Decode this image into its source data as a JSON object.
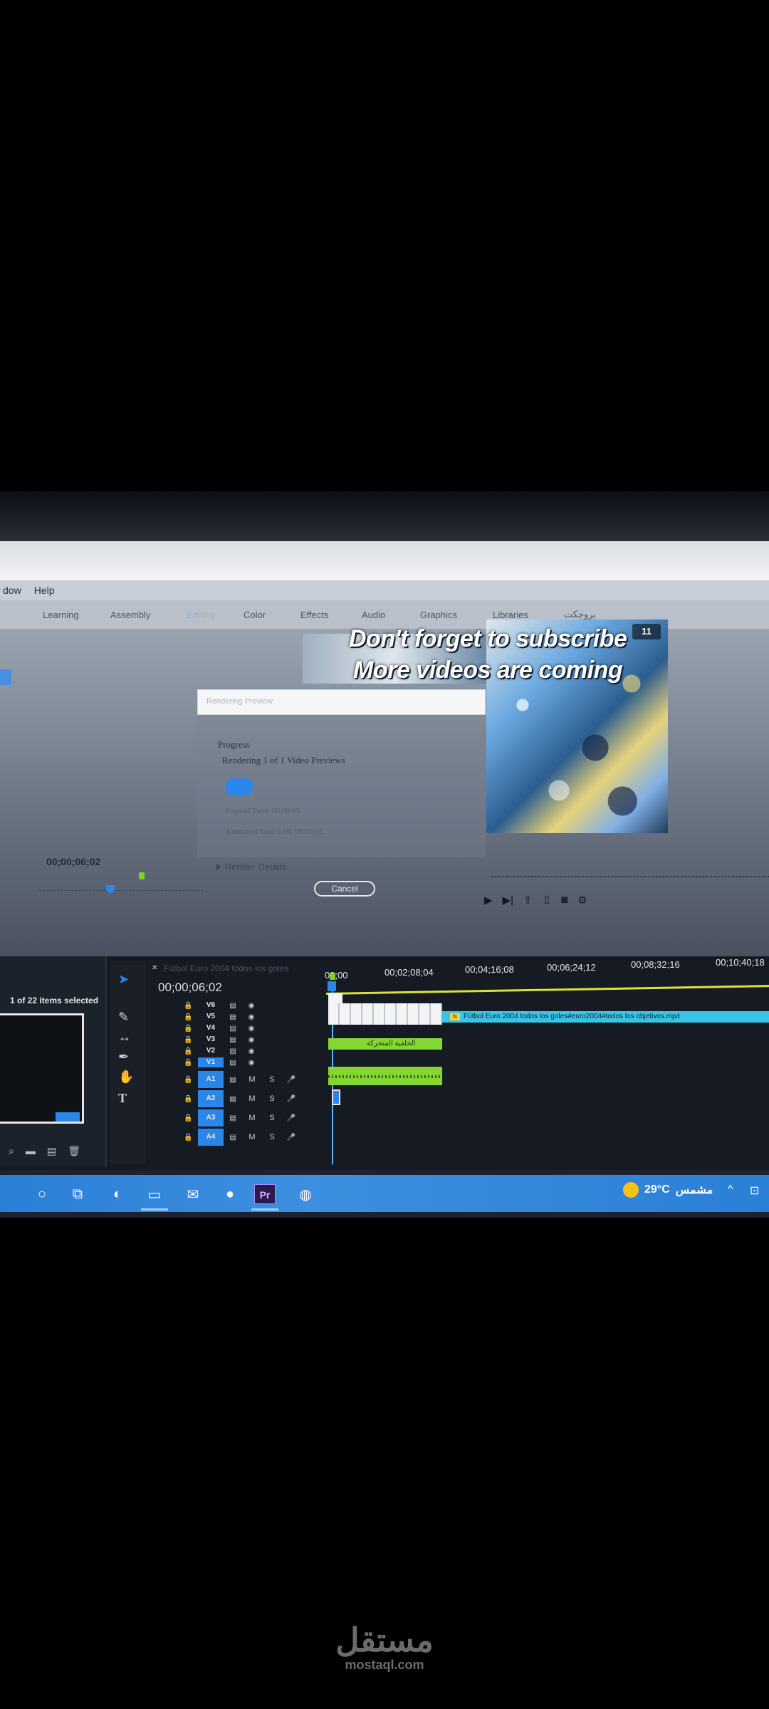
{
  "menu": {
    "items": [
      "dow",
      "Help"
    ]
  },
  "workspaces": {
    "tabs": [
      "Learning",
      "Assembly",
      "Editing",
      "Color",
      "Effects",
      "Audio",
      "Graphics",
      "Libraries",
      "بروجكت"
    ]
  },
  "preview": {
    "badge": "11",
    "line1": "Don't forget to subscribe",
    "line2": "More videos are coming"
  },
  "render_dialog": {
    "title": "Rendering Preview",
    "progress_label": "Progress",
    "status": "Rendering 1 of 1 Video Previews",
    "progress": 0.05,
    "elapsed": "Elapsed Time: 00;00;05",
    "remaining": "Estimated Time Left: 00;00;02",
    "details_label": "Render Details",
    "cancel_label": "Cancel"
  },
  "source_monitor": {
    "timecode": "00;00;06;02"
  },
  "project_panel": {
    "selection": "1 of 22 items selected"
  },
  "timeline": {
    "sequence_name": "Fútbol Euro 2004 todos los goles",
    "timecode": "00;00;06;02",
    "ruler": [
      "00;00",
      "00;02;08;04",
      "00;04;16;08",
      "00;06;24;12",
      "00;08;32;16",
      "00;10;40;18"
    ],
    "video_tracks": [
      "V6",
      "V5",
      "V4",
      "V3",
      "V2",
      "V1"
    ],
    "audio_tracks": [
      "A1",
      "A2",
      "A3",
      "A4"
    ],
    "track_letters": {
      "mute": "M",
      "solo": "S"
    },
    "clip_main": "Fútbol Euro 2004 todos los goles#euro2004#todos los objetivos.mp4",
    "clip_fx": "fx",
    "clip_text": "الخلفية المتحركة"
  },
  "taskbar": {
    "temperature": "29°C",
    "weather_text": "مشمس",
    "premiere": "Pr"
  },
  "watermark": {
    "arabic": "مستقل",
    "latin": "mostaql.com"
  }
}
